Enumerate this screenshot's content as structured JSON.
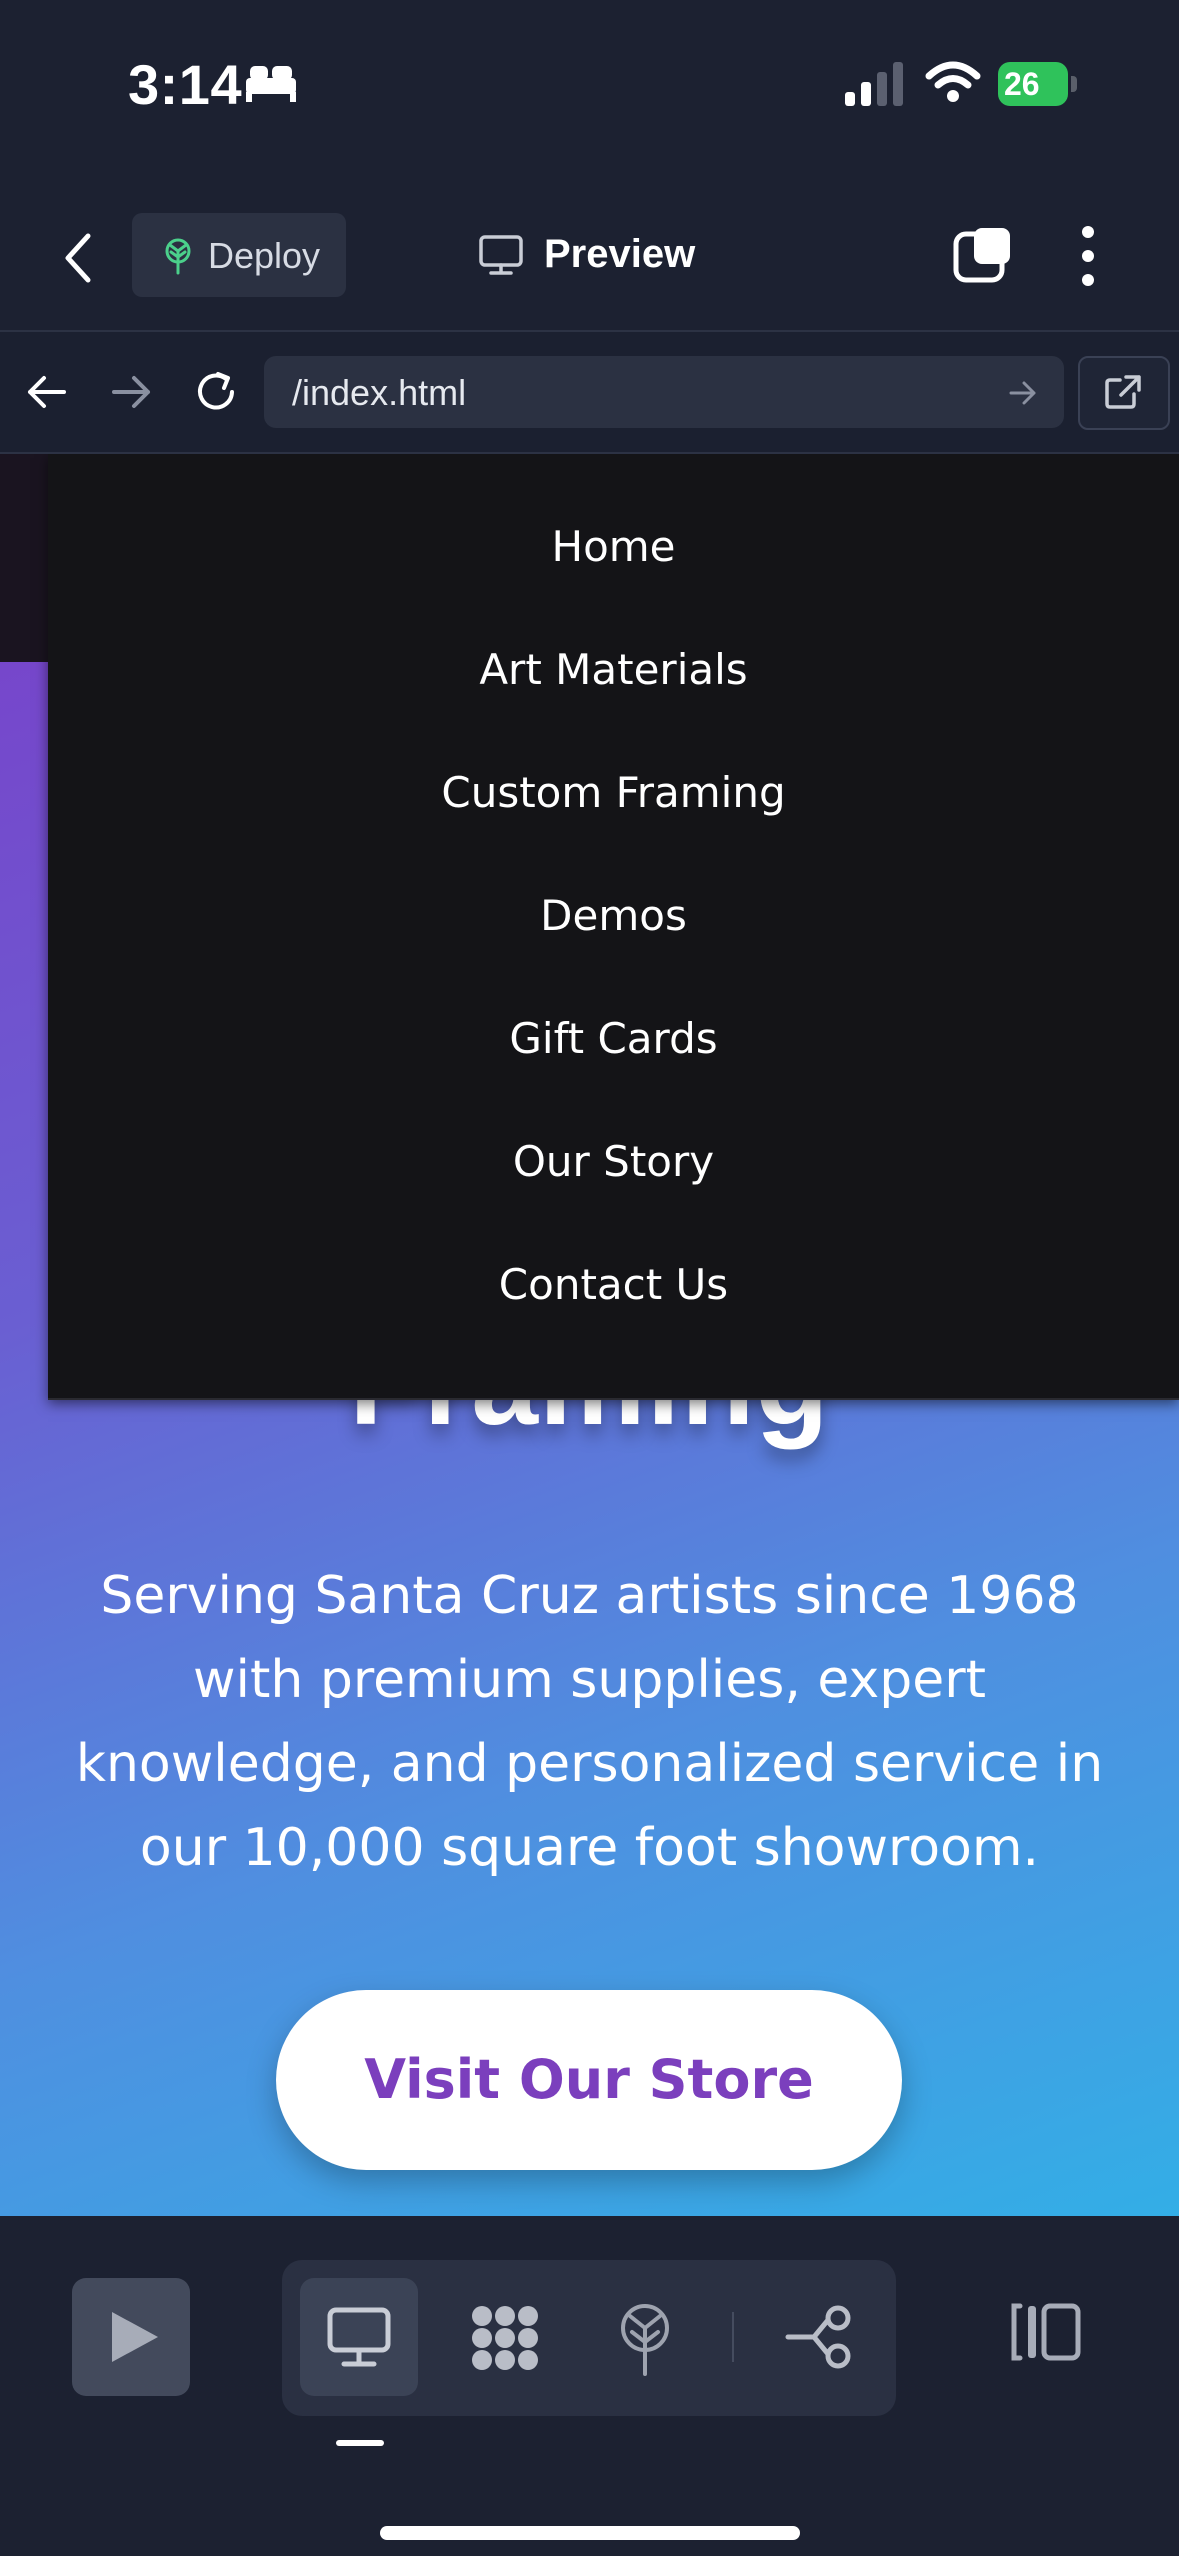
{
  "status": {
    "time": "3:14",
    "battery": "26"
  },
  "toolbar": {
    "deploy_label": "Deploy",
    "preview_label": "Preview"
  },
  "urlbar": {
    "url": "/index.html"
  },
  "menu": {
    "items": [
      {
        "label": "Home"
      },
      {
        "label": "Art Materials"
      },
      {
        "label": "Custom Framing"
      },
      {
        "label": "Demos"
      },
      {
        "label": "Gift Cards"
      },
      {
        "label": "Our Story"
      },
      {
        "label": "Contact Us"
      }
    ]
  },
  "hero": {
    "heading_partial": "Framing",
    "text": "Serving Santa Cruz artists since 1968 with premium supplies, expert knowledge, and personalized service in our 10,000 square foot showroom.",
    "cta_label": "Visit Our Store"
  },
  "colors": {
    "accent_purple": "#7b3fbd",
    "deploy_green": "#4bd08b",
    "battery_green": "#2fc25b",
    "chrome_bg": "#1c2131"
  },
  "icons": {
    "back": "chevron-left-icon",
    "deploy": "deploy-tree-icon",
    "preview": "monitor-icon",
    "tabs": "tabs-icon",
    "more": "more-vertical-icon",
    "nav_back": "arrow-left-icon",
    "nav_forward": "arrow-right-icon",
    "reload": "reload-icon",
    "go": "go-arrow-icon",
    "open_external": "open-external-icon",
    "play": "play-icon",
    "desktop": "monitor-icon",
    "blocks": "blocks-icon",
    "deploy_bottom": "deploy-tree-icon",
    "flow": "flow-icon",
    "panel": "panel-toggle-icon"
  }
}
